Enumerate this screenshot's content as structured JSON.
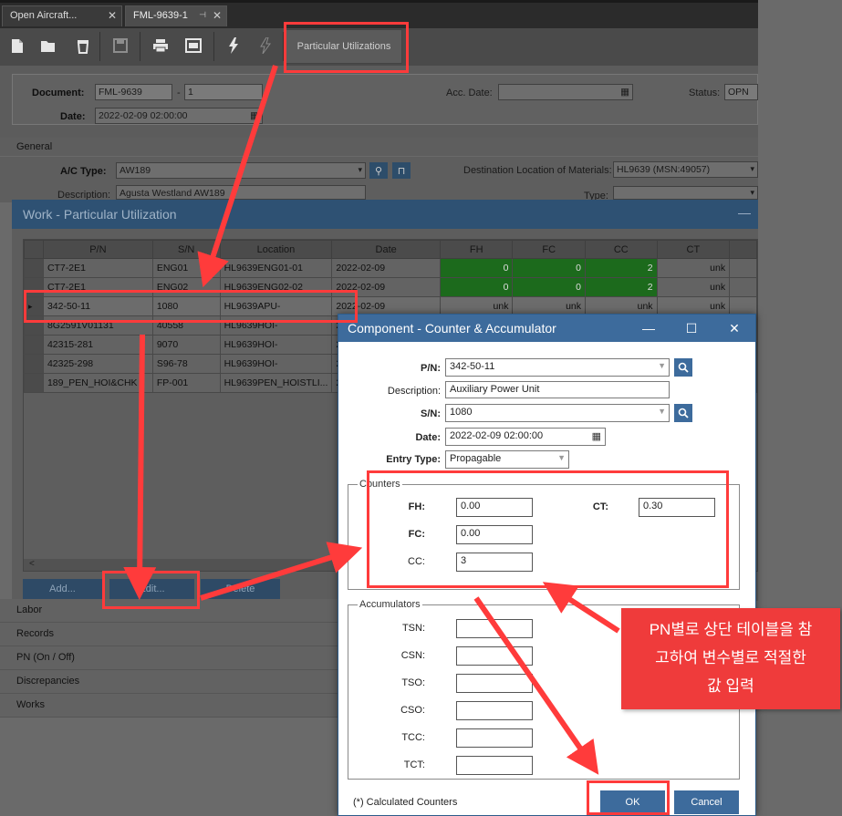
{
  "tabs": [
    {
      "label": "Open Aircraft..."
    },
    {
      "label": "FML-9639-1"
    }
  ],
  "toolbar": {
    "particular_utilizations": "Particular Utilizations"
  },
  "document": {
    "document_label": "Document:",
    "document_value": "FML-9639",
    "document_sep": "-",
    "document_suffix": "1",
    "date_label": "Date:",
    "date_value": "2022-02-09 02:00:00",
    "acc_date_label": "Acc. Date:",
    "acc_date_value": "",
    "status_label": "Status:",
    "status_value": "OPN"
  },
  "general": {
    "section": "General",
    "ac_type_label": "A/C Type:",
    "ac_type_value": "AW189",
    "description_label": "Description:",
    "description_value": "Agusta Westland AW189",
    "dest_label": "Destination Location of Materials:",
    "dest_value": "HL9639 (MSN:49057)",
    "type_label": "Type:",
    "type_value": ""
  },
  "work_panel": {
    "title": "Work - Particular Utilization",
    "minimize": "—"
  },
  "grid": {
    "columns": [
      "P/N",
      "S/N",
      "Location",
      "Date",
      "FH",
      "FC",
      "CC",
      "CT"
    ],
    "rows": [
      {
        "pn": "CT7-2E1",
        "sn": "ENG01",
        "location": "HL9639ENG01-01",
        "date": "2022-02-09",
        "fh": "0",
        "fc": "0",
        "cc": "2",
        "ct": "unk"
      },
      {
        "pn": "CT7-2E1",
        "sn": "ENG02",
        "location": "HL9639ENG02-02",
        "date": "2022-02-09",
        "fh": "0",
        "fc": "0",
        "cc": "2",
        "ct": "unk"
      },
      {
        "pn": "342-50-11",
        "sn": "1080",
        "location": "HL9639APU-",
        "date": "2022-02-09",
        "fh": "unk",
        "fc": "unk",
        "cc": "unk",
        "ct": "unk"
      },
      {
        "pn": "8G2591V01131",
        "sn": "40558",
        "location": "HL9639HOI-",
        "date": "2",
        "fh": "",
        "fc": "",
        "cc": "",
        "ct": ""
      },
      {
        "pn": "42315-281",
        "sn": "9070",
        "location": "HL9639HOI-",
        "date": "2",
        "fh": "",
        "fc": "",
        "cc": "",
        "ct": ""
      },
      {
        "pn": "42325-298",
        "sn": "S96-78",
        "location": "HL9639HOI-",
        "date": "2",
        "fh": "",
        "fc": "",
        "cc": "",
        "ct": ""
      },
      {
        "pn": "189_PEN_HOI&CHK",
        "sn": "FP-001",
        "location": "HL9639PEN_HOISTLI...",
        "date": "2",
        "fh": "",
        "fc": "",
        "cc": "",
        "ct": ""
      }
    ],
    "scroll_left": "<"
  },
  "grid_buttons": {
    "add": "Add...",
    "edit": "Edit...",
    "delete": "Delete"
  },
  "sections": [
    "Labor",
    "Records",
    "PN (On / Off)",
    "Discrepancies",
    "Works"
  ],
  "dialog": {
    "title": "Component - Counter & Accumulator",
    "pn_label": "P/N:",
    "pn_value": "342-50-11",
    "description_label": "Description:",
    "description_value": "Auxiliary Power Unit",
    "sn_label": "S/N:",
    "sn_value": "1080",
    "date_label": "Date:",
    "date_value": "2022-02-09 02:00:00",
    "entry_type_label": "Entry Type:",
    "entry_type_value": "Propagable",
    "counters_legend": "Counters",
    "fh_label": "FH:",
    "fh_value": "0.00",
    "fc_label": "FC:",
    "fc_value": "0.00",
    "cc_label": "CC:",
    "cc_value": "3",
    "ct_label": "CT:",
    "ct_value": "0.30",
    "accumulators_legend": "Accumulators",
    "acc": [
      {
        "label": "TSN:"
      },
      {
        "label": "CSN:"
      },
      {
        "label": "TSO:"
      },
      {
        "label": "CSO:"
      },
      {
        "label": "TCC:"
      },
      {
        "label": "TCT:"
      }
    ],
    "footnote": "(*) Calculated Counters",
    "ok": "OK",
    "cancel": "Cancel"
  },
  "annotation": {
    "line1": "PN별로 상단 테이블을 참",
    "line2": "고하여 변수별로 적절한",
    "line3": "값 입력"
  },
  "colors": {
    "highlight": "#ff3b3b",
    "dialog_header": "#3d6b9c",
    "green_cell": "#1c6a1c"
  }
}
